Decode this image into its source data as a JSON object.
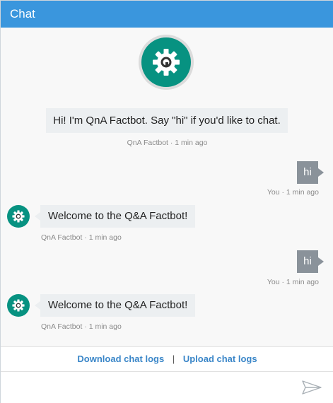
{
  "header": {
    "title": "Chat"
  },
  "colors": {
    "header": "#3a96dd",
    "bot_avatar": "#079281",
    "user_bubble": "#8a929a",
    "link": "#3a86c8"
  },
  "intro": {
    "text": "Hi! I'm QnA Factbot. Say \"hi\" if you'd like to chat.",
    "meta": "QnA Factbot · 1 min ago",
    "avatar_icon": "gear-icon"
  },
  "messages": [
    {
      "from": "user",
      "text": "hi",
      "meta": "You · 1 min ago"
    },
    {
      "from": "bot",
      "text": "Welcome to the Q&A Factbot!",
      "meta": "QnA Factbot · 1 min ago",
      "avatar_icon": "gear-icon"
    },
    {
      "from": "user",
      "text": "hi",
      "meta": "You · 1 min ago"
    },
    {
      "from": "bot",
      "text": "Welcome to the Q&A Factbot!",
      "meta": "QnA Factbot · 1 min ago",
      "avatar_icon": "gear-icon"
    }
  ],
  "links": {
    "download": "Download chat logs",
    "separator": "|",
    "upload": "Upload chat logs"
  },
  "composer": {
    "placeholder": "",
    "value": "",
    "send_icon": "send-icon"
  }
}
